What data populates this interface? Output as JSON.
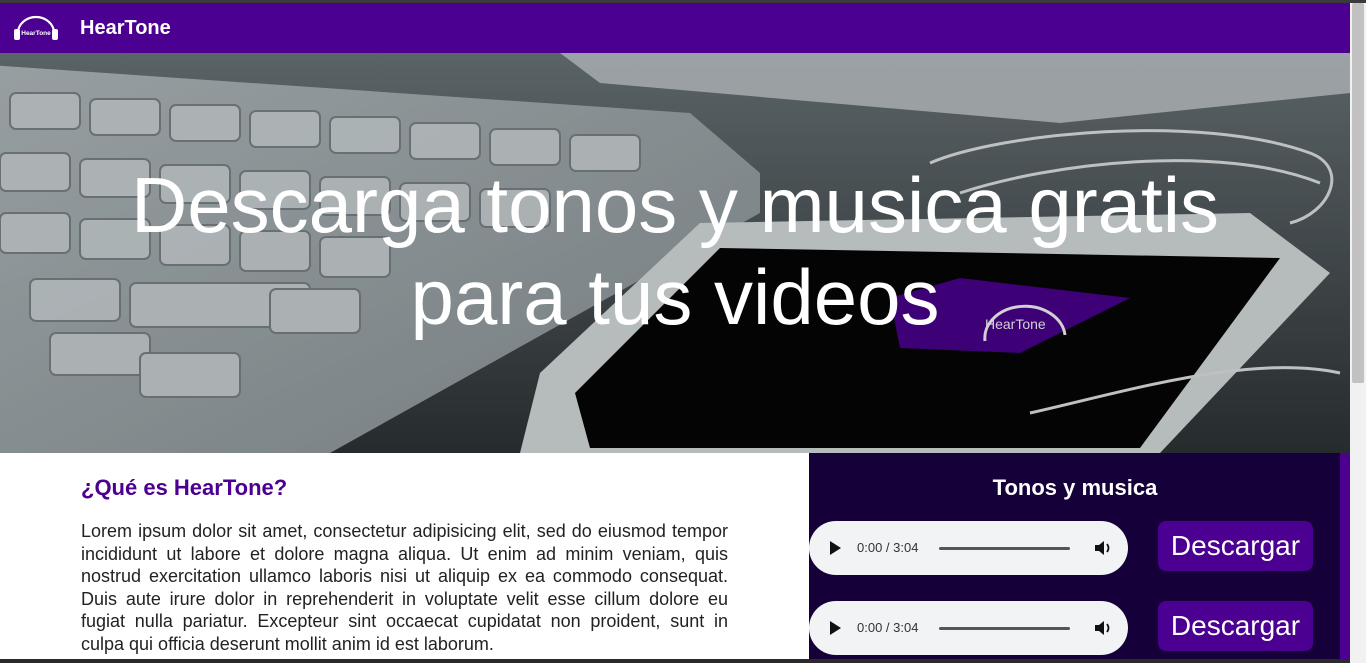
{
  "header": {
    "brand": "HearTone",
    "logo_text": "HearTone",
    "brand_color": "#4b0092"
  },
  "hero": {
    "title_line1": "Descarga tonos y musica gratis",
    "title_line2": "para tus videos",
    "phone_logo_text": "HearTone"
  },
  "article": {
    "heading": "¿Qué es HearTone?",
    "body": "Lorem ipsum dolor sit amet, consectetur adipisicing elit, sed do eiusmod tempor incididunt ut labore et dolore magna aliqua. Ut enim ad minim veniam, quis nostrud exercitation ullamco laboris nisi ut aliquip ex ea commodo consequat. Duis aute irure dolor in reprehenderit in voluptate velit esse cillum dolore eu fugiat nulla pariatur. Excepteur sint occaecat cupidatat non proident, sunt in culpa qui officia deserunt mollit anim id est laborum."
  },
  "panel": {
    "heading": "Tonos y musica",
    "tracks": [
      {
        "time": "0:00 / 3:04",
        "download_label": "Descargar"
      },
      {
        "time": "0:00 / 3:04",
        "download_label": "Descargar"
      }
    ],
    "panel_color": "#15003a"
  }
}
